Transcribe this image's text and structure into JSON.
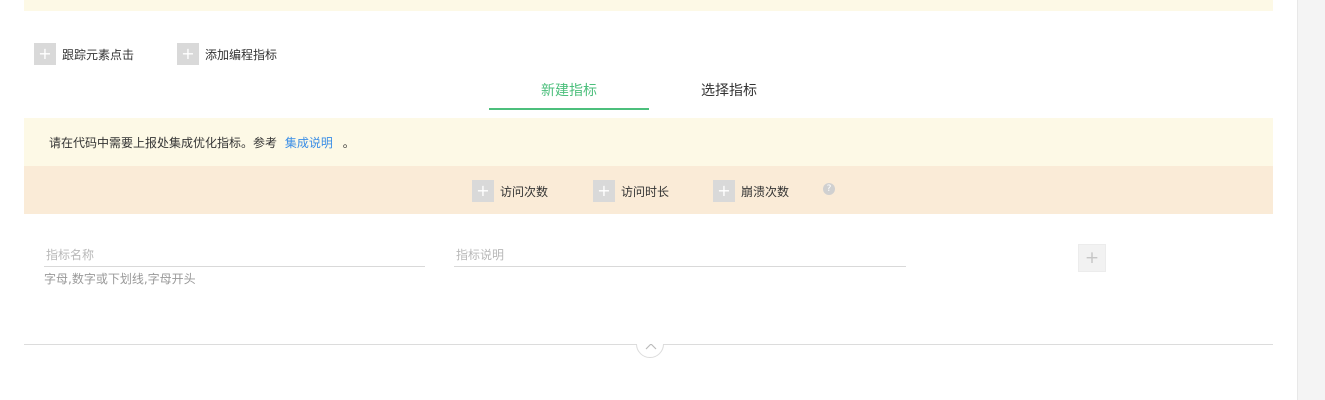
{
  "actions": {
    "track_click": "跟踪元素点击",
    "add_program_metric": "添加编程指标"
  },
  "tabs": [
    {
      "label": "新建指标",
      "active": true
    },
    {
      "label": "选择指标",
      "active": false
    }
  ],
  "info": {
    "text": "请在代码中需要上报处集成优化指标。参考",
    "link": "集成说明",
    "suffix": "。"
  },
  "presets": [
    "访问次数",
    "访问时长",
    "崩溃次数"
  ],
  "form": {
    "name_placeholder": "指标名称",
    "name_hint": "字母,数字或下划线,字母开头",
    "desc_placeholder": "指标说明",
    "add_symbol": "+"
  },
  "icons": {
    "plus": "plus-icon",
    "help": "question-circle-icon",
    "collapse": "chevron-up-icon"
  },
  "colors": {
    "accent": "#4cbf7c",
    "link": "#3a8ee6",
    "info_bg": "#fdf9e6",
    "preset_bg": "#faebd7"
  }
}
